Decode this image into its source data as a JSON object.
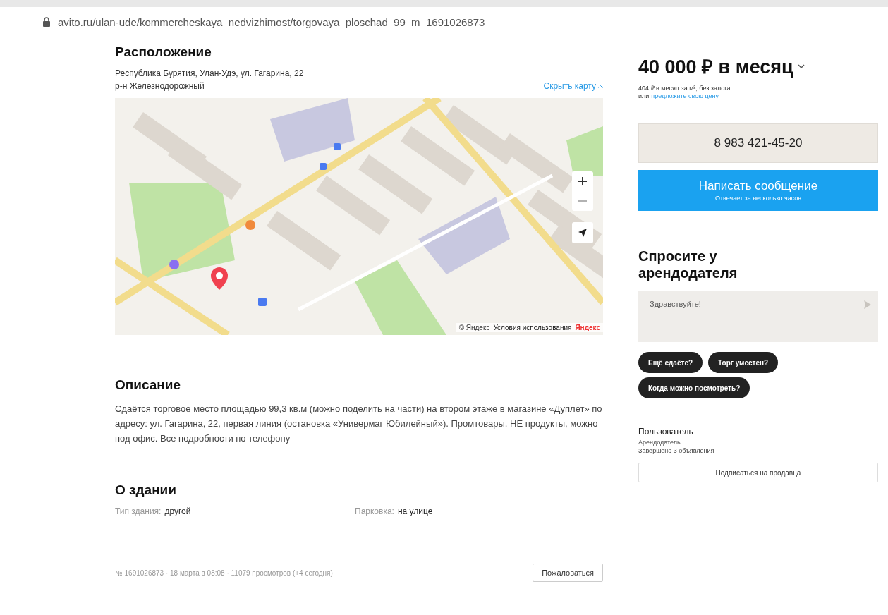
{
  "address_bar": {
    "url": "avito.ru/ulan-ude/kommercheskaya_nedvizhimost/torgovaya_ploschad_99_m_1691026873"
  },
  "location": {
    "title": "Расположение",
    "address": "Республика Бурятия, Улан-Удэ, ул. Гагарина, 22",
    "district": "р-н Железнодорожный",
    "toggle_map": "Скрыть карту",
    "map": {
      "attribution": "© Яндекс",
      "terms": "Условия использования",
      "brand": "Яндекс"
    }
  },
  "description": {
    "title": "Описание",
    "text": "Сдаётся торговое место площадью 99,3 кв.м (можно поделить на части) на втором этаже в магазине «Дуплет» по адресу: ул. Гагарина, 22, первая линия (остановка «Универмаг Юбилейный»). Промтовары, НЕ продукты, можно под офис. Все подробности по телефону"
  },
  "building": {
    "title": "О здании",
    "params": [
      {
        "label": "Тип здания:",
        "value": "другой"
      },
      {
        "label": "Парковка:",
        "value": "на улице"
      }
    ]
  },
  "footer": {
    "meta": "№ 1691026873 · 18 марта в 08:08 · 11079 просмотров (+4 сегодня)",
    "report": "Пожаловаться"
  },
  "sidebar": {
    "price": "40 000 ₽ в месяц",
    "price_note": "404 ₽ в месяц за м², без залога",
    "offer_prefix": "или",
    "offer_link": "предложите свою цену",
    "phone": "8 983 421-45-20",
    "message_button": "Написать сообщение",
    "message_note": "Отвечает за несколько часов",
    "ask_title": "Спросите у арендодателя",
    "ask_value": "Здравствуйте!",
    "chips": [
      "Ещё сдаёте?",
      "Торг уместен?",
      "Когда можно посмотреть?"
    ],
    "seller_name": "Пользователь",
    "seller_role": "Арендодатель",
    "seller_stats": "Завершено 3 объявления",
    "subscribe": "Подписаться на продавца"
  }
}
